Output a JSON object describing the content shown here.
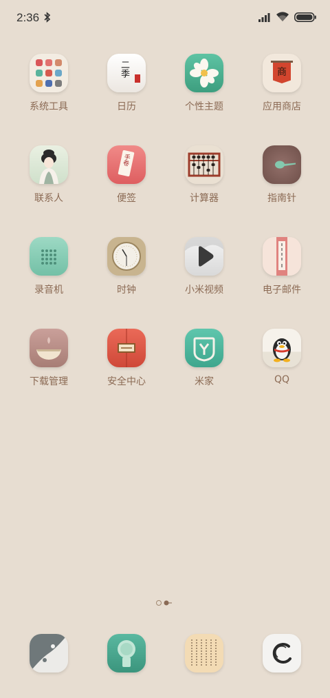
{
  "status_bar": {
    "time": "2:36",
    "icons": [
      "bluetooth-icon",
      "signal-icon",
      "wifi-icon",
      "battery-icon"
    ]
  },
  "apps": [
    {
      "label": "系统工具"
    },
    {
      "label": "日历",
      "icon_text": "二季"
    },
    {
      "label": "个性主题"
    },
    {
      "label": "应用商店",
      "icon_text": "商"
    },
    {
      "label": "联系人"
    },
    {
      "label": "便签",
      "icon_text": "手卷"
    },
    {
      "label": "计算器"
    },
    {
      "label": "指南针"
    },
    {
      "label": "录音机"
    },
    {
      "label": "时钟"
    },
    {
      "label": "小米视频"
    },
    {
      "label": "电子邮件"
    },
    {
      "label": "下载管理"
    },
    {
      "label": "安全中心"
    },
    {
      "label": "米家"
    },
    {
      "label": "QQ"
    }
  ],
  "dock": [
    {
      "name": "yin-yang-app"
    },
    {
      "name": "green-seal-app"
    },
    {
      "name": "poem-scroll-app"
    },
    {
      "name": "ink-circle-app"
    }
  ],
  "colors": {
    "background": "#e7ddd1",
    "label": "#8b6a54"
  }
}
